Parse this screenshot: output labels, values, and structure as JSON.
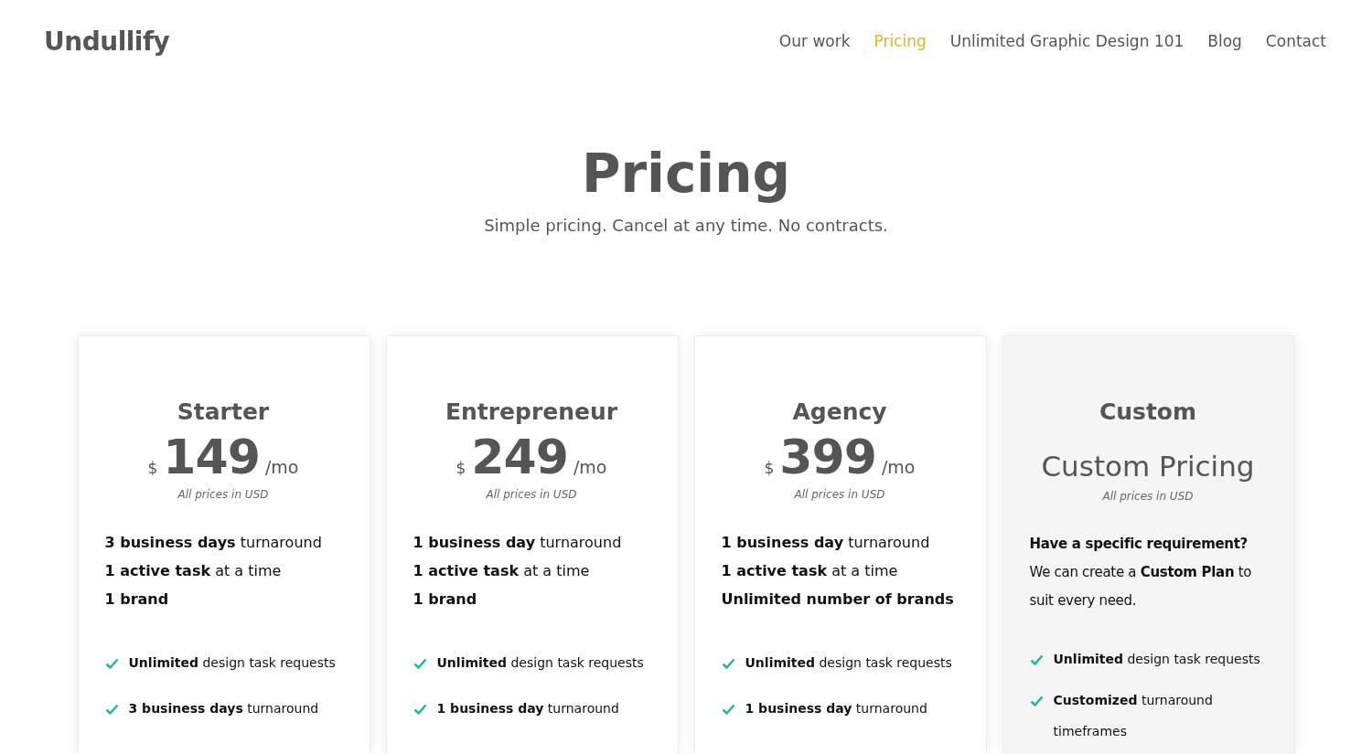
{
  "header": {
    "logo": "Undullify",
    "nav": [
      {
        "label": "Our work",
        "selected": false
      },
      {
        "label": "Pricing",
        "selected": true
      },
      {
        "label": "Unlimited Graphic Design 101",
        "selected": false
      },
      {
        "label": "Blog",
        "selected": false
      },
      {
        "label": "Contact",
        "selected": false
      }
    ]
  },
  "hero": {
    "title": "Pricing",
    "subtitle": "Simple pricing. Cancel at any time. No contracts."
  },
  "plans": [
    {
      "kind": "fixed",
      "name": "Starter",
      "currency": "$",
      "amount": "149",
      "period": "/mo",
      "note": "All prices in USD",
      "details": [
        "**3 business days** turnaround",
        "**1 active task** at a time",
        "**1 brand**"
      ],
      "features": [
        "**Unlimited** design task requests",
        "**3 business days** turnaround"
      ]
    },
    {
      "kind": "fixed",
      "name": "Entrepreneur",
      "currency": "$",
      "amount": "249",
      "period": "/mo",
      "note": "All prices in USD",
      "details": [
        "**1 business day** turnaround",
        "**1 active task** at a time",
        "**1 brand**"
      ],
      "features": [
        "**Unlimited** design task requests",
        "**1 business day** turnaround"
      ]
    },
    {
      "kind": "fixed",
      "name": "Agency",
      "currency": "$",
      "amount": "399",
      "period": "/mo",
      "note": "All prices in USD",
      "details": [
        "**1 business day** turnaround",
        "**1 active task** at a time",
        "**Unlimited number of brands**"
      ],
      "features": [
        "**Unlimited** design task requests",
        "**1 business day** turnaround"
      ]
    },
    {
      "kind": "custom",
      "name": "Custom",
      "price_text": "Custom Pricing",
      "note": "All prices in USD",
      "details": [
        "**Have a specific requirement?**",
        "We can create a **Custom Plan** to suit every need."
      ],
      "features": [
        "**Unlimited** design task requests",
        "**Customized** turnaround timeframes"
      ]
    }
  ]
}
